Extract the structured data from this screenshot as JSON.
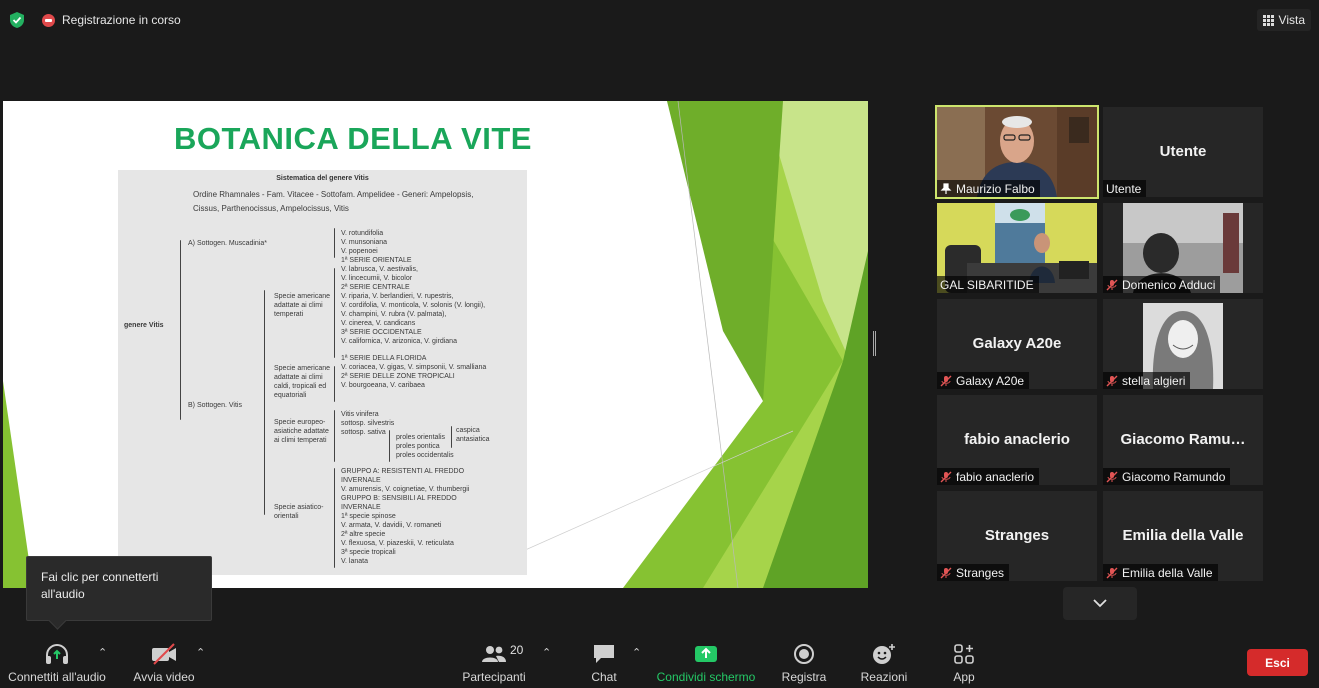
{
  "top_bar": {
    "recording_label": "Registrazione in corso",
    "view_label": "Vista"
  },
  "slide": {
    "title": "BOTANICA DELLA VITE",
    "scan": {
      "heading": "Sistematica del genere Vitis",
      "intro_line_1": "Ordine Rhamnales - Fam. Vitacee - Sottofam. Ampelidee - Generi: Ampelopsis,",
      "intro_line_2": "Cissus, Parthenocissus, Ampelocissus, Vitis",
      "genus": "genere Vitis",
      "subgenus_a": "A) Sottogen. Muscadinia*",
      "subgenus_b": "B) Sottogen. Vitis",
      "group_1": [
        "Specie americane",
        "adattate ai climi",
        "temperati"
      ],
      "group_2": [
        "Specie americane",
        "adattate ai climi",
        "caldi, tropicali ed",
        "equatoriali"
      ],
      "group_3": [
        "Specie europeo-",
        "asiatiche adattate",
        "ai climi temperati"
      ],
      "group_4": [
        "Specie asiatico-",
        "orientali"
      ],
      "muscadinia_species": [
        "V. rotundifolia",
        "V. munsoniana",
        "V. popenoei"
      ],
      "temperate_series": [
        "1ª SERIE ORIENTALE",
        "V. labrusca, V. aestivalis,",
        "V. lincecumii, V. bicolor",
        "2ª SERIE CENTRALE",
        "V. riparia, V. berlandieri, V. rupestris,",
        "V. cordifolia, V. monticola, V. solonis (V. longii),",
        "V. champini, V. rubra (V. palmata),",
        "V. cinerea, V. candicans",
        "3ª SERIE OCCIDENTALE",
        "V. californica, V. arizonica, V. girdiana"
      ],
      "tropical_series": [
        "1ª SERIE DELLA FLORIDA",
        "V. coriacea, V. gigas, V. simpsonii, V. smalliana",
        "2ª SERIE DELLE ZONE TROPICALI",
        "V. bourgoeana, V. caribaea"
      ],
      "european_species": [
        "Vitis vinifera",
        "sottosp. silvestris",
        "",
        "sottosp. sativa"
      ],
      "proles": [
        "proles orientalis",
        "proles pontica",
        "proles occidentalis"
      ],
      "proles_sub": [
        "caspica",
        "",
        "antasiatica"
      ],
      "asian_groups": [
        "GRUPPO A: RESISTENTI AL FREDDO",
        "INVERNALE",
        "V. amurensis, V. coignetiae, V. thumbergii",
        "GRUPPO B: SENSIBILI AL FREDDO",
        "INVERNALE",
        "1ª specie spinose",
        "V. armata, V. davidii, V. romaneti",
        "2ª altre specie",
        "V. flexuosa, V. piazeskii, V. reticulata",
        "3ª specie tropicali",
        "V. lanata"
      ]
    }
  },
  "gallery": {
    "tiles": [
      {
        "label": "Maurizio Falbo",
        "center": "",
        "muted": false,
        "pinned": true
      },
      {
        "label": "Utente",
        "center": "Utente",
        "muted": false
      },
      {
        "label": "GAL SIBARITIDE",
        "center": "",
        "muted": false
      },
      {
        "label": "Domenico Adduci",
        "center": "",
        "muted": true
      },
      {
        "label": "Galaxy A20e",
        "center": "Galaxy A20e",
        "muted": true
      },
      {
        "label": "stella algieri",
        "center": "",
        "muted": true
      },
      {
        "label": "fabio anaclerio",
        "center": "fabio anaclerio",
        "muted": true
      },
      {
        "label": "Giacomo Ramundo",
        "center": "Giacomo  Ramu…",
        "muted": true
      },
      {
        "label": "Stranges",
        "center": "Stranges",
        "muted": true
      },
      {
        "label": "Emilia della Valle",
        "center": "Emilia della Valle",
        "muted": true
      }
    ]
  },
  "tooltip": {
    "line_1": "Fai clic per connetterti",
    "line_2": "all'audio"
  },
  "toolbar": {
    "audio_label": "Connettiti all'audio",
    "video_label": "Avvia video",
    "participants_label": "Partecipanti",
    "participants_count": "20",
    "chat_label": "Chat",
    "share_label": "Condividi schermo",
    "record_label": "Registra",
    "reactions_label": "Reazioni",
    "apps_label": "App",
    "leave_label": "Esci"
  },
  "colors": {
    "active_speaker_border": "#cde56d",
    "share_green": "#24c866",
    "leave_red": "#d52b2b",
    "slide_title_green": "#1aa65a"
  }
}
